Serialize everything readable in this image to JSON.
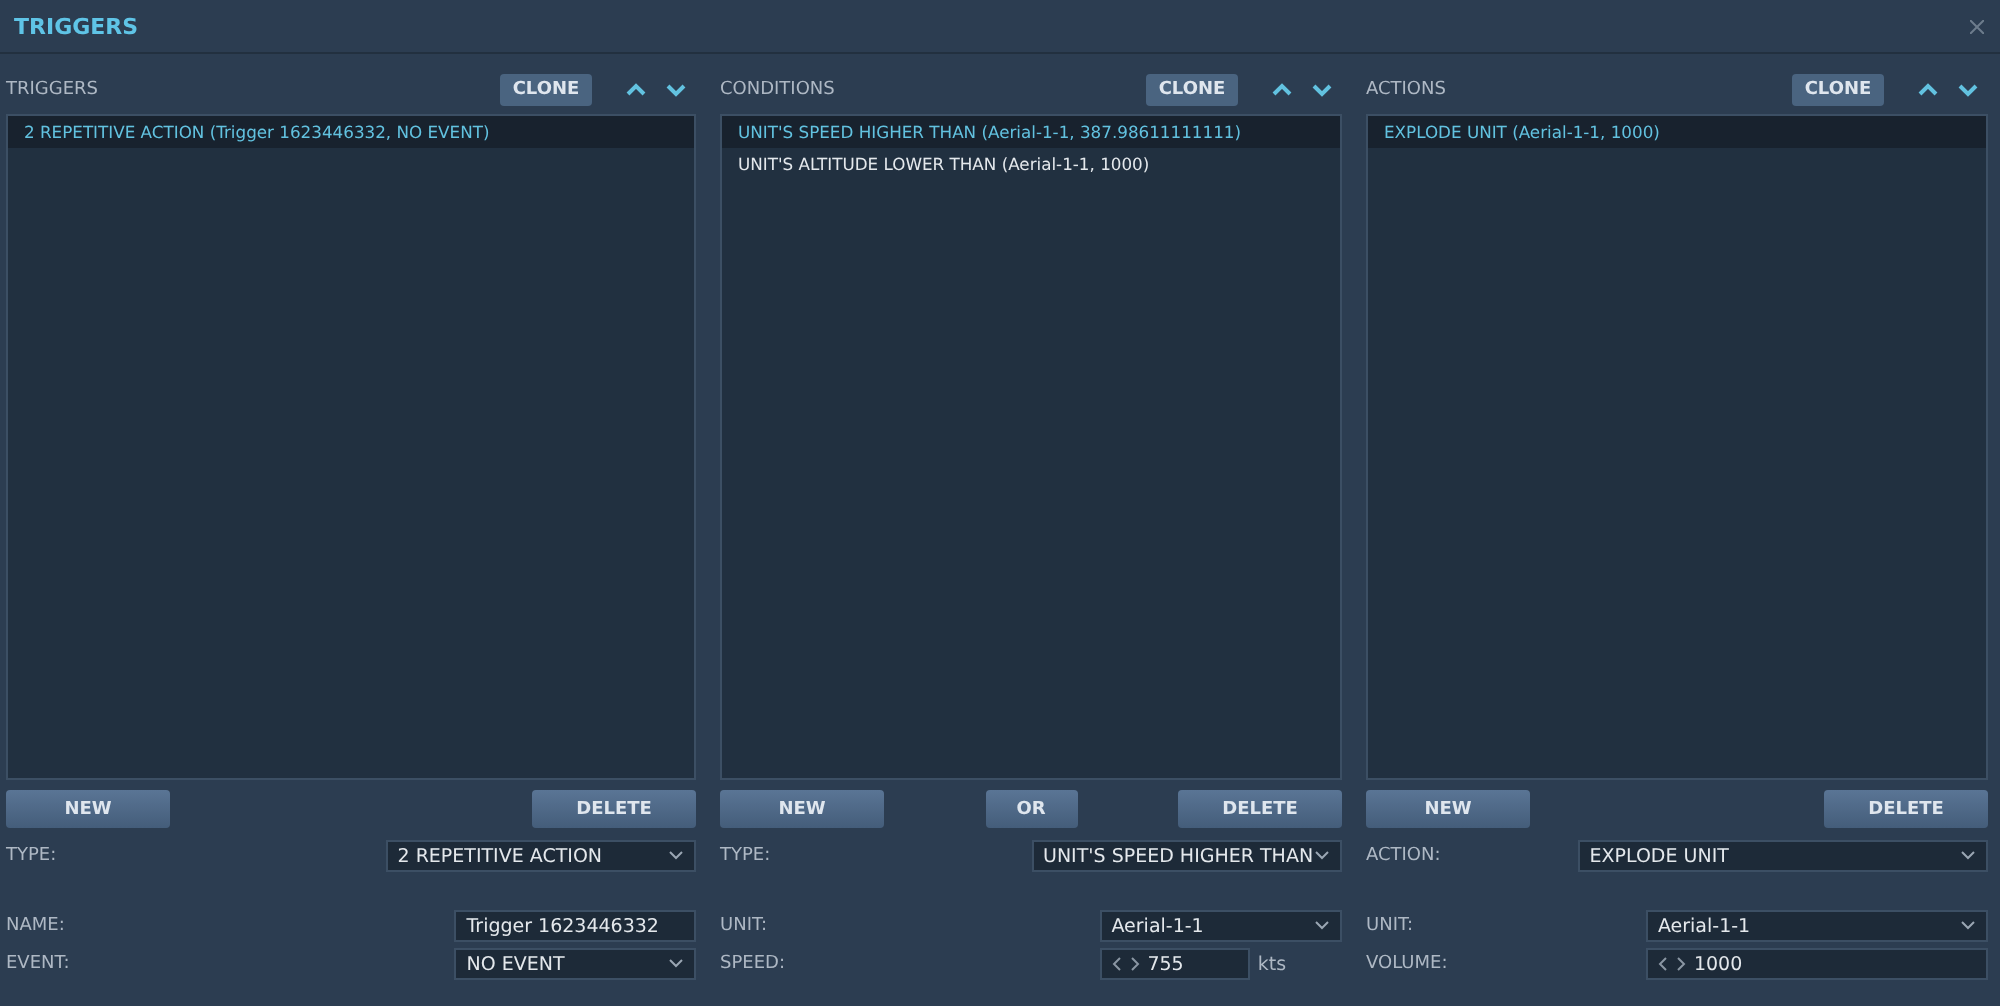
{
  "window": {
    "title": "TRIGGERS"
  },
  "panels": [
    {
      "heading": "TRIGGERS",
      "clone": "CLONE",
      "items": [
        {
          "label": "2 REPETITIVE ACTION (Trigger 1623446332, NO EVENT)",
          "selected": true
        }
      ],
      "buttons": [
        "NEW",
        "DELETE"
      ],
      "type": {
        "label": "TYPE:",
        "value": "2 REPETITIVE ACTION"
      },
      "fields": [
        {
          "kind": "text",
          "label": "NAME:",
          "value": "Trigger 1623446332"
        },
        {
          "kind": "select",
          "label": "EVENT:",
          "value": "NO EVENT"
        }
      ]
    },
    {
      "heading": "CONDITIONS",
      "clone": "CLONE",
      "items": [
        {
          "label": "UNIT'S SPEED HIGHER THAN (Aerial-1-1, 387.98611111111)",
          "selected": true
        },
        {
          "label": "UNIT'S ALTITUDE LOWER THAN (Aerial-1-1, 1000)",
          "selected": false
        }
      ],
      "buttons": [
        "NEW",
        "OR",
        "DELETE"
      ],
      "type": {
        "label": "TYPE:",
        "value": "UNIT'S SPEED HIGHER THAN"
      },
      "fields": [
        {
          "kind": "select",
          "label": "UNIT:",
          "value": "Aerial-1-1"
        },
        {
          "kind": "spinner",
          "label": "SPEED:",
          "value": "755",
          "unit": "kts"
        }
      ]
    },
    {
      "heading": "ACTIONS",
      "clone": "CLONE",
      "items": [
        {
          "label": "EXPLODE UNIT (Aerial-1-1, 1000)",
          "selected": true
        }
      ],
      "buttons": [
        "NEW",
        "DELETE"
      ],
      "type": {
        "label": "ACTION:",
        "value": "EXPLODE UNIT"
      },
      "fields": [
        {
          "kind": "select",
          "label": "UNIT:",
          "value": "Aerial-1-1"
        },
        {
          "kind": "spinner",
          "label": "VOLUME:",
          "value": "1000"
        }
      ]
    }
  ]
}
